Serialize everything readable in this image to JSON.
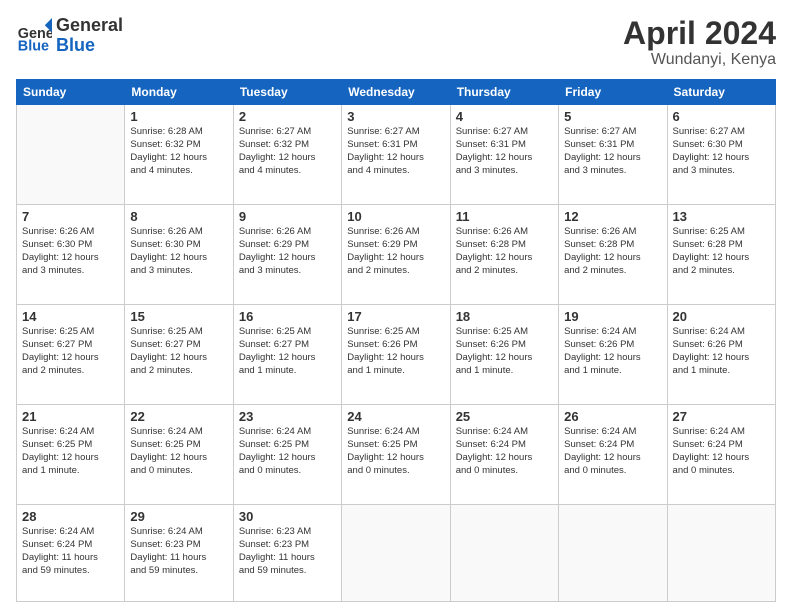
{
  "header": {
    "logo": {
      "general": "General",
      "blue": "Blue"
    },
    "title": "April 2024",
    "location": "Wundanyi, Kenya"
  },
  "weekdays": [
    "Sunday",
    "Monday",
    "Tuesday",
    "Wednesday",
    "Thursday",
    "Friday",
    "Saturday"
  ],
  "weeks": [
    [
      {
        "day": "",
        "info": ""
      },
      {
        "day": "1",
        "info": "Sunrise: 6:28 AM\nSunset: 6:32 PM\nDaylight: 12 hours\nand 4 minutes."
      },
      {
        "day": "2",
        "info": "Sunrise: 6:27 AM\nSunset: 6:32 PM\nDaylight: 12 hours\nand 4 minutes."
      },
      {
        "day": "3",
        "info": "Sunrise: 6:27 AM\nSunset: 6:31 PM\nDaylight: 12 hours\nand 4 minutes."
      },
      {
        "day": "4",
        "info": "Sunrise: 6:27 AM\nSunset: 6:31 PM\nDaylight: 12 hours\nand 3 minutes."
      },
      {
        "day": "5",
        "info": "Sunrise: 6:27 AM\nSunset: 6:31 PM\nDaylight: 12 hours\nand 3 minutes."
      },
      {
        "day": "6",
        "info": "Sunrise: 6:27 AM\nSunset: 6:30 PM\nDaylight: 12 hours\nand 3 minutes."
      }
    ],
    [
      {
        "day": "7",
        "info": "Sunrise: 6:26 AM\nSunset: 6:30 PM\nDaylight: 12 hours\nand 3 minutes."
      },
      {
        "day": "8",
        "info": "Sunrise: 6:26 AM\nSunset: 6:30 PM\nDaylight: 12 hours\nand 3 minutes."
      },
      {
        "day": "9",
        "info": "Sunrise: 6:26 AM\nSunset: 6:29 PM\nDaylight: 12 hours\nand 3 minutes."
      },
      {
        "day": "10",
        "info": "Sunrise: 6:26 AM\nSunset: 6:29 PM\nDaylight: 12 hours\nand 2 minutes."
      },
      {
        "day": "11",
        "info": "Sunrise: 6:26 AM\nSunset: 6:28 PM\nDaylight: 12 hours\nand 2 minutes."
      },
      {
        "day": "12",
        "info": "Sunrise: 6:26 AM\nSunset: 6:28 PM\nDaylight: 12 hours\nand 2 minutes."
      },
      {
        "day": "13",
        "info": "Sunrise: 6:25 AM\nSunset: 6:28 PM\nDaylight: 12 hours\nand 2 minutes."
      }
    ],
    [
      {
        "day": "14",
        "info": "Sunrise: 6:25 AM\nSunset: 6:27 PM\nDaylight: 12 hours\nand 2 minutes."
      },
      {
        "day": "15",
        "info": "Sunrise: 6:25 AM\nSunset: 6:27 PM\nDaylight: 12 hours\nand 2 minutes."
      },
      {
        "day": "16",
        "info": "Sunrise: 6:25 AM\nSunset: 6:27 PM\nDaylight: 12 hours\nand 1 minute."
      },
      {
        "day": "17",
        "info": "Sunrise: 6:25 AM\nSunset: 6:26 PM\nDaylight: 12 hours\nand 1 minute."
      },
      {
        "day": "18",
        "info": "Sunrise: 6:25 AM\nSunset: 6:26 PM\nDaylight: 12 hours\nand 1 minute."
      },
      {
        "day": "19",
        "info": "Sunrise: 6:24 AM\nSunset: 6:26 PM\nDaylight: 12 hours\nand 1 minute."
      },
      {
        "day": "20",
        "info": "Sunrise: 6:24 AM\nSunset: 6:26 PM\nDaylight: 12 hours\nand 1 minute."
      }
    ],
    [
      {
        "day": "21",
        "info": "Sunrise: 6:24 AM\nSunset: 6:25 PM\nDaylight: 12 hours\nand 1 minute."
      },
      {
        "day": "22",
        "info": "Sunrise: 6:24 AM\nSunset: 6:25 PM\nDaylight: 12 hours\nand 0 minutes."
      },
      {
        "day": "23",
        "info": "Sunrise: 6:24 AM\nSunset: 6:25 PM\nDaylight: 12 hours\nand 0 minutes."
      },
      {
        "day": "24",
        "info": "Sunrise: 6:24 AM\nSunset: 6:25 PM\nDaylight: 12 hours\nand 0 minutes."
      },
      {
        "day": "25",
        "info": "Sunrise: 6:24 AM\nSunset: 6:24 PM\nDaylight: 12 hours\nand 0 minutes."
      },
      {
        "day": "26",
        "info": "Sunrise: 6:24 AM\nSunset: 6:24 PM\nDaylight: 12 hours\nand 0 minutes."
      },
      {
        "day": "27",
        "info": "Sunrise: 6:24 AM\nSunset: 6:24 PM\nDaylight: 12 hours\nand 0 minutes."
      }
    ],
    [
      {
        "day": "28",
        "info": "Sunrise: 6:24 AM\nSunset: 6:24 PM\nDaylight: 11 hours\nand 59 minutes."
      },
      {
        "day": "29",
        "info": "Sunrise: 6:24 AM\nSunset: 6:23 PM\nDaylight: 11 hours\nand 59 minutes."
      },
      {
        "day": "30",
        "info": "Sunrise: 6:23 AM\nSunset: 6:23 PM\nDaylight: 11 hours\nand 59 minutes."
      },
      {
        "day": "",
        "info": ""
      },
      {
        "day": "",
        "info": ""
      },
      {
        "day": "",
        "info": ""
      },
      {
        "day": "",
        "info": ""
      }
    ]
  ]
}
